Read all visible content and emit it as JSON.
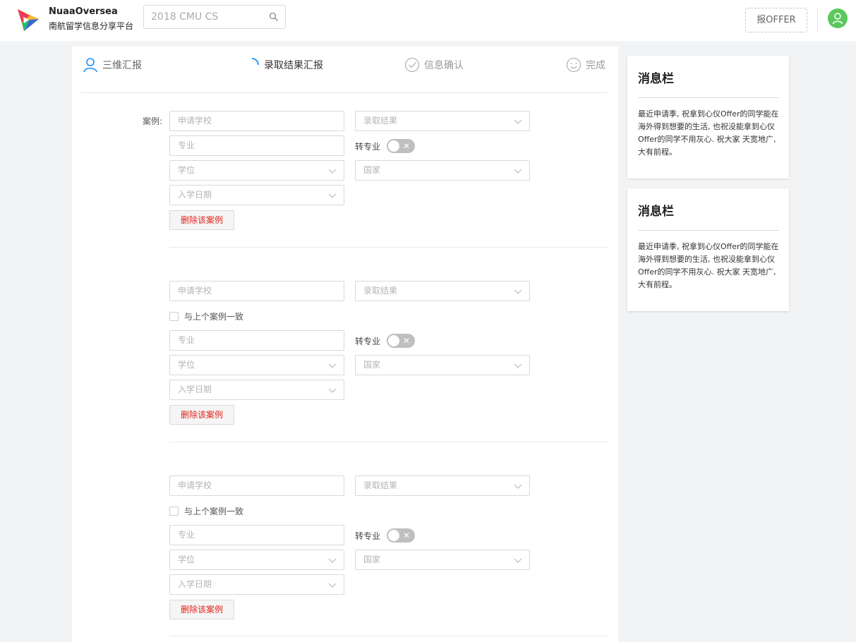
{
  "header": {
    "brand_title": "NuaaOversea",
    "brand_subtitle": "南航留学信息分享平台",
    "search_placeholder": "2018 CMU CS",
    "report_button": "报OFFER",
    "brand_colors": [
      "#f7b731",
      "#eb3b5a",
      "#3867d6",
      "#20bf6b"
    ],
    "avatar_color": "#5cc85c"
  },
  "steps": [
    {
      "label": "三维汇报",
      "icon": "user-icon",
      "state": "done"
    },
    {
      "label": "录取结果汇报",
      "icon": "loading-icon",
      "state": "active"
    },
    {
      "label": "信息确认",
      "icon": "check-circle-icon",
      "state": "pending"
    },
    {
      "label": "完成",
      "icon": "smile-icon",
      "state": "pending"
    }
  ],
  "form": {
    "case_label": "案例:",
    "school_placeholder": "申请学校",
    "result_placeholder": "录取结果",
    "major_placeholder": "专业",
    "switch_major_label": "转专业",
    "switch_off_symbol": "✕",
    "degree_placeholder": "学位",
    "country_placeholder": "国家",
    "enroll_date_placeholder": "入学日期",
    "delete_button": "删除该案例",
    "same_as_previous": "与上个案例一致",
    "cases": [
      {
        "index": 1,
        "switch_major": false,
        "same_as_previous": null
      },
      {
        "index": 2,
        "switch_major": false,
        "same_as_previous": false
      },
      {
        "index": 3,
        "switch_major": false,
        "same_as_previous": false
      }
    ]
  },
  "sidebar": {
    "panels": [
      {
        "title": "消息栏",
        "body": "最近申请季, 祝拿到心仪Offer的同学能在海外得到想要的生活, 也祝没能拿到心仪Offer的同学不用灰心. 祝大家 天宽地广, 大有前程。"
      },
      {
        "title": "消息栏",
        "body": "最近申请季, 祝拿到心仪Offer的同学能在海外得到想要的生活, 也祝没能拿到心仪Offer的同学不用灰心. 祝大家 天宽地广, 大有前程。"
      }
    ]
  }
}
